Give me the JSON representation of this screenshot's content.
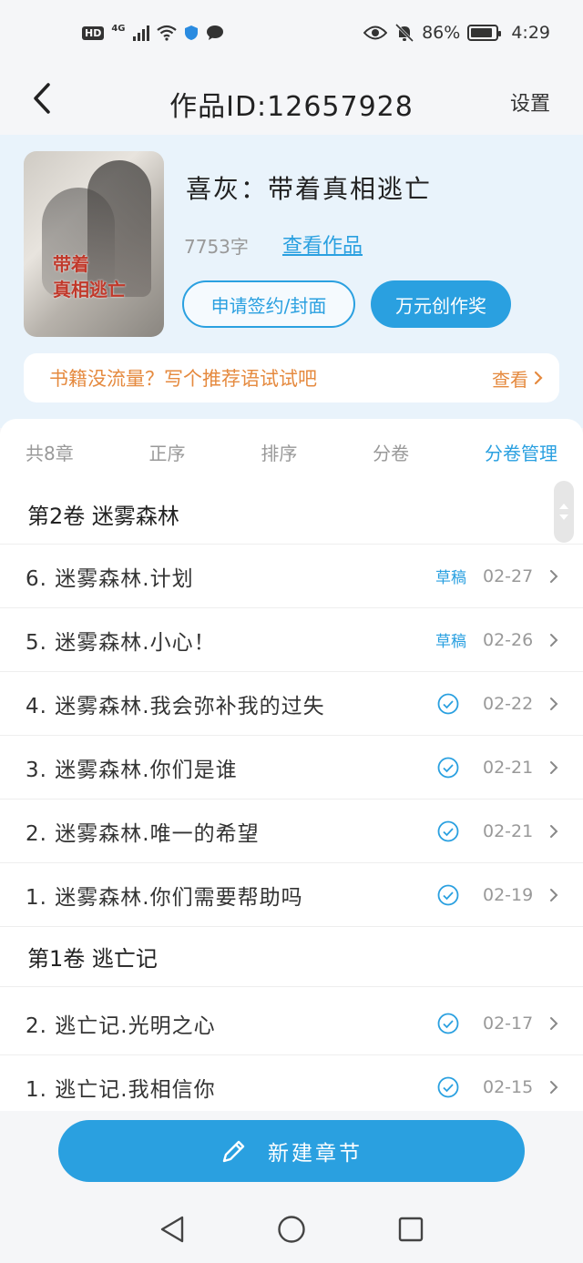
{
  "status_bar": {
    "hd": "HD",
    "network": "4G",
    "battery_percent": "86%",
    "battery_level": 0.86,
    "time": "4:29"
  },
  "nav": {
    "title": "作品ID:12657928",
    "settings_label": "设置"
  },
  "book": {
    "cover_text": "带着\n真相逃亡",
    "title": "喜灰：带着真相逃亡",
    "word_count": "7753字",
    "view_work_label": "查看作品",
    "apply_button": "申请签约/封面",
    "award_button": "万元创作奖"
  },
  "promo": {
    "text": "书籍没流量？写个推荐语试试吧",
    "link_label": "查看"
  },
  "toolbar": {
    "total": "共8章",
    "order": "正序",
    "sort": "排序",
    "split": "分卷",
    "manage": "分卷管理"
  },
  "volumes": [
    {
      "title": "第2卷 迷雾森林",
      "chapters": [
        {
          "title": "6. 迷雾森林.计划",
          "status": "草稿",
          "date": "02-27"
        },
        {
          "title": "5. 迷雾森林.小心！",
          "status": "草稿",
          "date": "02-26"
        },
        {
          "title": "4. 迷雾森林.我会弥补我的过失",
          "status": "published",
          "date": "02-22"
        },
        {
          "title": "3. 迷雾森林.你们是谁",
          "status": "published",
          "date": "02-21"
        },
        {
          "title": "2. 迷雾森林.唯一的希望",
          "status": "published",
          "date": "02-21"
        },
        {
          "title": "1. 迷雾森林.你们需要帮助吗",
          "status": "published",
          "date": "02-19"
        }
      ]
    },
    {
      "title": "第1卷 逃亡记",
      "chapters": [
        {
          "title": "2. 逃亡记.光明之心",
          "status": "published",
          "date": "02-17"
        },
        {
          "title": "1. 逃亡记.我相信你",
          "status": "published",
          "date": "02-15"
        }
      ]
    }
  ],
  "new_chapter_button": "新建章节",
  "colors": {
    "accent": "#2aa0e0",
    "promo": "#e58a3f",
    "header_bg": "#e9f3fb"
  }
}
